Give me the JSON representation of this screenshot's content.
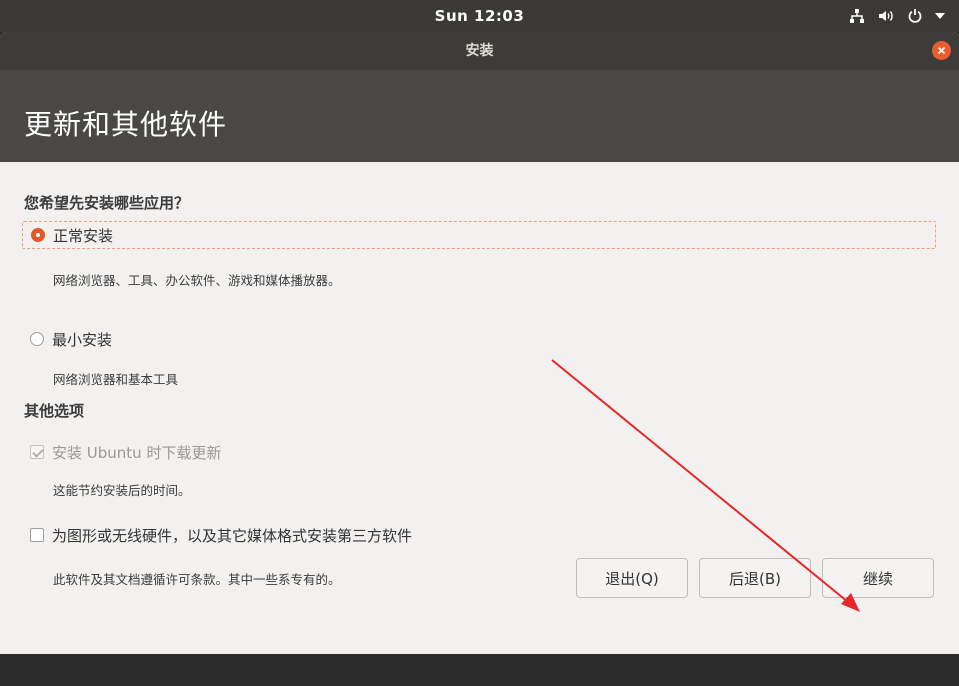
{
  "top_panel": {
    "clock": "Sun 12:03",
    "indicators": [
      "network-icon",
      "volume-icon",
      "power-icon",
      "chevron-down-icon"
    ]
  },
  "window": {
    "title": "安装",
    "page_title": "更新和其他软件",
    "close_icon": "close-icon"
  },
  "install_type": {
    "heading": "您希望先安装哪些应用？",
    "options": [
      {
        "label": "正常安装",
        "description": "网络浏览器、工具、办公软件、游戏和媒体播放器。",
        "selected": true
      },
      {
        "label": "最小安装",
        "description": "网络浏览器和基本工具",
        "selected": false
      }
    ]
  },
  "other_options": {
    "heading": "其他选项",
    "items": [
      {
        "label": "安装 Ubuntu 时下载更新",
        "description": "这能节约安装后的时间。",
        "checked": true,
        "disabled": true
      },
      {
        "label": "为图形或无线硬件，以及其它媒体格式安装第三方软件",
        "description": "此软件及其文档遵循许可条款。其中一些系专有的。",
        "checked": false,
        "disabled": false
      }
    ]
  },
  "buttons": {
    "quit": "退出(Q)",
    "back": "后退(B)",
    "continue": "继续"
  },
  "colors": {
    "accent": "#e95420",
    "annotation_arrow": "#e8262a",
    "header_bg": "#4a4845",
    "window_bg": "#f2f1f0"
  }
}
